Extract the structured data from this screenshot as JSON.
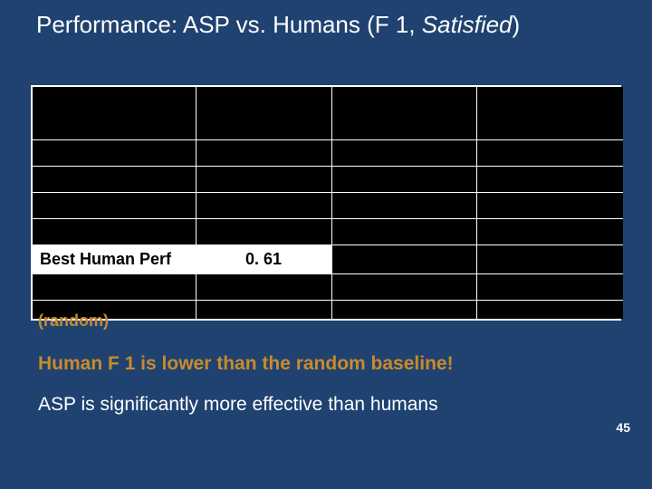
{
  "title_prefix": "Performance: ASP vs. Humans (F 1, ",
  "title_em": "Satisfied",
  "title_suffix": ")",
  "table": {
    "r0": {
      "c0": "",
      "c1": "",
      "c2": "",
      "c3": ""
    },
    "r1": {
      "c0": "",
      "c1": "",
      "c2": "",
      "c3": ""
    },
    "r2": {
      "c0": "",
      "c1": "",
      "c2": "",
      "c3": ""
    },
    "r3": {
      "c0": "",
      "c1": "",
      "c2": "",
      "c3": ""
    },
    "r4": {
      "c0": "",
      "c1": "",
      "c2": "",
      "c3": ""
    },
    "r5": {
      "c0": "Best Human Perf",
      "c1": "0. 61",
      "c2": "",
      "c3": ""
    },
    "r6": {
      "c0": "",
      "c1": "",
      "c2": "",
      "c3": ""
    },
    "r7": {
      "c0": "",
      "c1": "",
      "c2": "",
      "c3": ""
    }
  },
  "random_label": "(random)",
  "callout1": "Human F 1 is lower than the random baseline!",
  "callout2": "ASP is significantly more effective than humans",
  "pagenum": "45",
  "chart_data": {
    "type": "table",
    "title": "Performance: ASP vs. Humans (F1, Satisfied)",
    "visible_cells": [
      {
        "row_label": "Best Human Perf",
        "value": 0.61
      }
    ],
    "note": "Most table cells are occluded/rendered black in the source image; only one row label and one numeric cell are legible."
  }
}
